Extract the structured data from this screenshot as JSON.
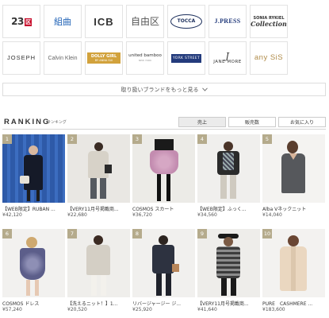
{
  "brands": {
    "row1": [
      {
        "name": "23区",
        "icon": "23ku-logo"
      },
      {
        "name": "組曲",
        "icon": "kumikyoku-logo"
      },
      {
        "name": "ICB",
        "icon": "icb-logo"
      },
      {
        "name": "自由区",
        "icon": "jiyuku-logo"
      },
      {
        "name": "TOCCA",
        "icon": "tocca-logo"
      },
      {
        "name": "J.PRESS",
        "icon": "jpress-logo"
      },
      {
        "name": "SONIA RYKIEL",
        "sub": "Collection",
        "icon": "sonia-rykiel-logo"
      }
    ],
    "row2": [
      {
        "name": "JOSEPH",
        "icon": "joseph-logo"
      },
      {
        "name": "Calvin Klein",
        "icon": "calvin-klein-logo"
      },
      {
        "name": "DOLLY GIRL",
        "sub": "BY ANNA SUI",
        "icon": "dolly-girl-logo"
      },
      {
        "name": "united bamboo",
        "sub": "NEW YORK",
        "icon": "united-bamboo-logo"
      },
      {
        "name": "YORK STREET",
        "icon": "york-street-logo"
      },
      {
        "name": "JANE MORE",
        "icon": "jane-more-logo"
      },
      {
        "name": "any SiS",
        "icon": "any-sis-logo"
      }
    ]
  },
  "more_brands": {
    "label": "取り扱いブランドをもっと見る",
    "icon": "chevron-down-icon"
  },
  "ranking": {
    "title": "RANKING",
    "subtitle": "ランキング",
    "tabs": [
      "売上",
      "販売数",
      "お気に入り"
    ],
    "active_tab": "売上",
    "items": [
      {
        "rank": "1",
        "name": "【WEB限定】RUBAN ...",
        "price": "¥42,120"
      },
      {
        "rank": "2",
        "name": "【VERY11月号掲載商...",
        "price": "¥22,680"
      },
      {
        "rank": "3",
        "name": "COSMOS スカート",
        "price": "¥36,720"
      },
      {
        "rank": "4",
        "name": "【WEB限定】ふっく...",
        "price": "¥34,560"
      },
      {
        "rank": "5",
        "name": "Alba Vネックニット",
        "price": "¥14,040"
      },
      {
        "rank": "6",
        "name": "COSMOS ドレス",
        "price": "¥57,240"
      },
      {
        "rank": "7",
        "name": "【洗えるニット！】1...",
        "price": "¥20,520"
      },
      {
        "rank": "8",
        "name": "リバージャージー ジ...",
        "price": "¥25,920"
      },
      {
        "rank": "9",
        "name": "【VERY11月号掲載商...",
        "price": "¥41,640"
      },
      {
        "rank": "10",
        "name": "PURE　CASHMERE ...",
        "price": "¥183,600"
      }
    ]
  },
  "colors": {
    "rank_badge": "#b5ab8c",
    "tab_active_bg": "#ebebeb",
    "accent_red": "#c8102e"
  }
}
